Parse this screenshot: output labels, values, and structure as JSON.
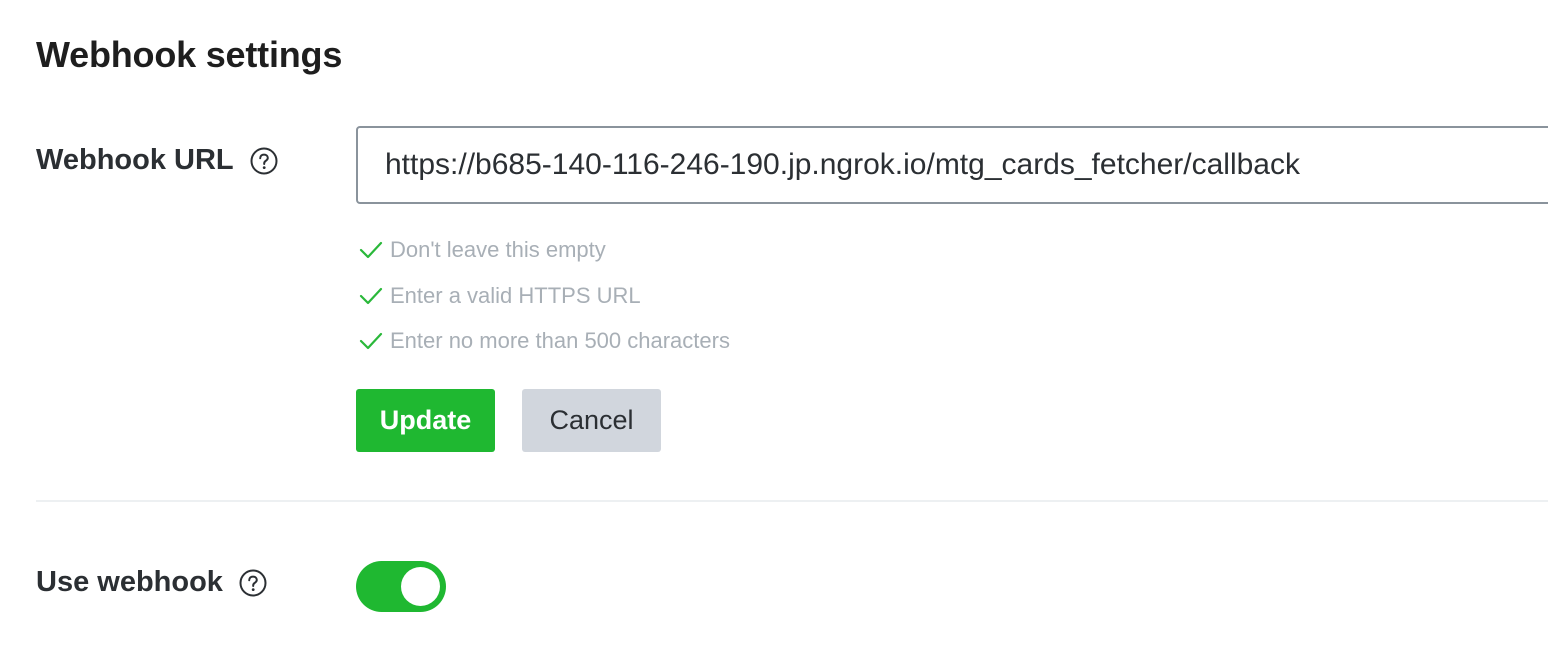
{
  "section": {
    "title": "Webhook settings"
  },
  "webhook_url": {
    "label": "Webhook URL",
    "help_icon": "question-circle-icon",
    "value": "https://b685-140-116-246-190.jp.ngrok.io/mtg_cards_fetcher/callback",
    "validation_rules": [
      {
        "icon": "check-icon",
        "text": "Don't leave this empty"
      },
      {
        "icon": "check-icon",
        "text": "Enter a valid HTTPS URL"
      },
      {
        "icon": "check-icon",
        "text": "Enter no more than 500 characters"
      }
    ]
  },
  "actions": {
    "update_label": "Update",
    "cancel_label": "Cancel"
  },
  "use_webhook": {
    "label": "Use webhook",
    "help_icon": "question-circle-icon",
    "enabled": true
  },
  "colors": {
    "accent_green": "#1fb831",
    "check_green": "#2ab83a",
    "rule_text": "#a8afb6",
    "cancel_bg": "#d1d6dd",
    "input_border": "#8a939c"
  }
}
